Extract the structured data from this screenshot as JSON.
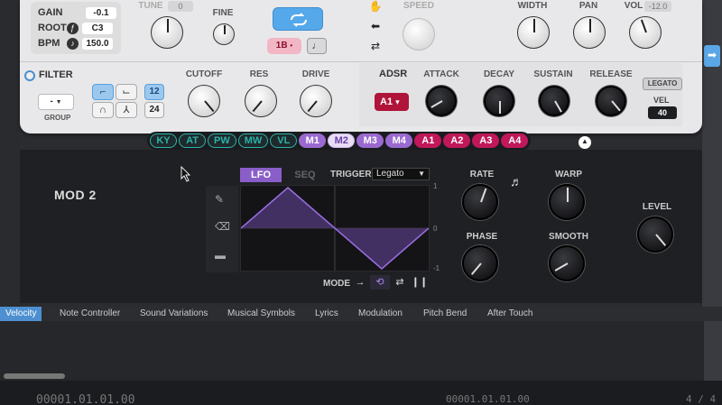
{
  "params": {
    "gain_label": "GAIN",
    "gain_value": "-0.1",
    "root_label": "ROOT",
    "root_value": "C3",
    "bpm_label": "BPM",
    "bpm_value": "150.0"
  },
  "top_knobs": {
    "tune_label": "TUNE",
    "tune_value": "0",
    "fine_label": "FINE",
    "speed_label": "SPEED",
    "width_label": "WIDTH",
    "pan_label": "PAN",
    "vol_label": "VOL",
    "vol_value": "-12.0"
  },
  "playback": {
    "sync_label": "1B",
    "sync_caret": "•",
    "note_glyph": "♩"
  },
  "filter": {
    "title": "FILTER",
    "group_value": "-",
    "group_caret": "▼",
    "group_label": "GROUP",
    "slope_12": "12",
    "slope_24": "24",
    "cutoff_label": "CUTOFF",
    "res_label": "RES",
    "drive_label": "DRIVE"
  },
  "adsr": {
    "title": "ADSR",
    "select_value": "A1",
    "select_caret": "▾",
    "attack_label": "ATTACK",
    "decay_label": "DECAY",
    "sustain_label": "SUSTAIN",
    "release_label": "RELEASE",
    "legato_label": "LEGATO",
    "vel_label": "VEL",
    "vel_value": "40"
  },
  "mod_tabs": [
    {
      "label": "KY",
      "kind": "teal"
    },
    {
      "label": "AT",
      "kind": "teal"
    },
    {
      "label": "PW",
      "kind": "teal"
    },
    {
      "label": "MW",
      "kind": "teal"
    },
    {
      "label": "VL",
      "kind": "teal"
    },
    {
      "label": "M1",
      "kind": "purple"
    },
    {
      "label": "M2",
      "kind": "purple-selected"
    },
    {
      "label": "M3",
      "kind": "purple"
    },
    {
      "label": "M4",
      "kind": "purple"
    },
    {
      "label": "A1",
      "kind": "magenta"
    },
    {
      "label": "A2",
      "kind": "magenta"
    },
    {
      "label": "A3",
      "kind": "magenta"
    },
    {
      "label": "A4",
      "kind": "magenta"
    }
  ],
  "mod": {
    "title": "MOD 2",
    "lfo_tab": "LFO",
    "seq_tab": "SEQ",
    "trigger_label": "TRIGGER",
    "trigger_value": "Legato",
    "scale_top": "1",
    "scale_mid": "0",
    "scale_bot": "-1",
    "mode_label": "MODE",
    "rate_label": "RATE",
    "warp_label": "WARP",
    "phase_label": "PHASE",
    "smooth_label": "SMOOTH",
    "level_label": "LEVEL"
  },
  "lanes": [
    "Velocity",
    "Note Controller",
    "Sound Variations",
    "Musical Symbols",
    "Lyrics",
    "Modulation",
    "Pitch Bend",
    "After Touch"
  ],
  "footer": {
    "time_left": "00001.01.01.00",
    "time_right": "00001.01.01.00",
    "page": "4 / 4"
  },
  "colors": {
    "accent_blue": "#55a8ea",
    "lfo_purple": "#8a5ec8",
    "adsr_red": "#b0143a",
    "teal": "#2ab3a8",
    "magenta": "#c0185a"
  }
}
